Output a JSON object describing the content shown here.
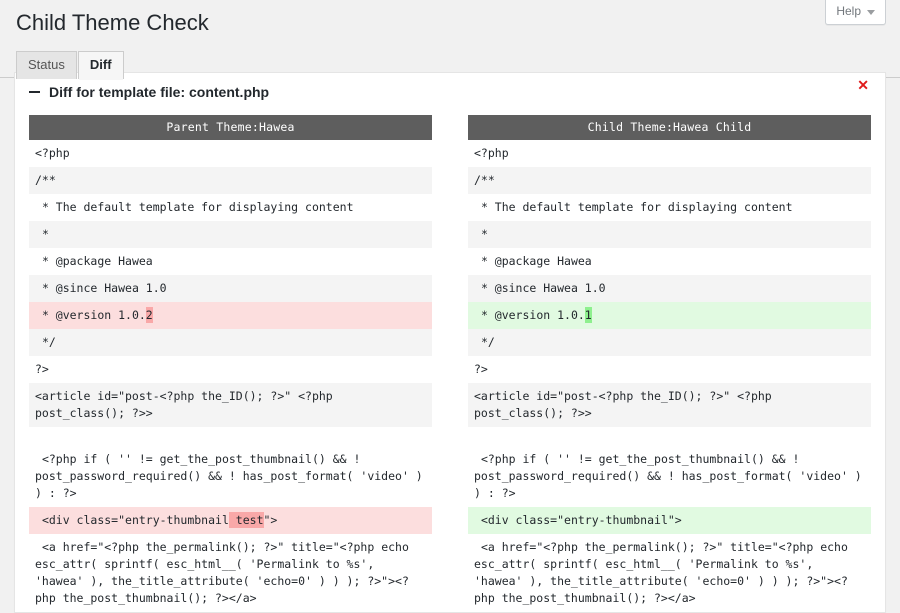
{
  "header": {
    "help_label": "Help",
    "help_icon": "chevron-down-icon"
  },
  "page": {
    "title": "Child Theme Check"
  },
  "tabs": [
    {
      "label": "Status",
      "active": false
    },
    {
      "label": "Diff",
      "active": true
    }
  ],
  "panel": {
    "toggle_icon": "minus-icon",
    "title": "Diff for template file: content.php",
    "close_icon": "close-icon",
    "close_label": "✕"
  },
  "diff": {
    "left": {
      "header": "Parent  Theme:Hawea",
      "lines": [
        {
          "type": "ctx",
          "text": "<?php"
        },
        {
          "type": "ctx",
          "text": "/**"
        },
        {
          "type": "ctx",
          "text": " * The default template for displaying content"
        },
        {
          "type": "ctx",
          "text": " *"
        },
        {
          "type": "ctx",
          "text": " * @package Hawea"
        },
        {
          "type": "ctx",
          "text": " * @since Hawea 1.0"
        },
        {
          "type": "del",
          "pre": " * @version 1.0.",
          "mark": "2",
          "post": ""
        },
        {
          "type": "ctx",
          "text": " */"
        },
        {
          "type": "ctx",
          "text": "?>"
        },
        {
          "type": "ctx",
          "text": "<article id=\"post-<?php the_ID(); ?>\" <?php post_class(); ?>>"
        },
        {
          "type": "spacer",
          "text": ""
        },
        {
          "type": "ctx",
          "text": " <?php if ( '' != get_the_post_thumbnail() && ! post_password_required() && ! has_post_format( 'video' ) ) : ?>"
        },
        {
          "type": "del",
          "pre": " <div class=\"entry-thumbnail",
          "mark": " test",
          "post": "\">"
        },
        {
          "type": "ctx",
          "text": " <a href=\"<?php the_permalink(); ?>\" title=\"<?php echo esc_attr( sprintf( esc_html__( 'Permalink to %s', 'hawea' ), the_title_attribute( 'echo=0' ) ) ); ?>\"><?php the_post_thumbnail(); ?></a>"
        }
      ]
    },
    "right": {
      "header": "Child Theme:Hawea Child",
      "lines": [
        {
          "type": "ctx",
          "text": "<?php"
        },
        {
          "type": "ctx",
          "text": "/**"
        },
        {
          "type": "ctx",
          "text": " * The default template for displaying content"
        },
        {
          "type": "ctx",
          "text": " *"
        },
        {
          "type": "ctx",
          "text": " * @package Hawea"
        },
        {
          "type": "ctx",
          "text": " * @since Hawea 1.0"
        },
        {
          "type": "ins",
          "pre": " * @version 1.0.",
          "mark": "1",
          "post": ""
        },
        {
          "type": "ctx",
          "text": " */"
        },
        {
          "type": "ctx",
          "text": "?>"
        },
        {
          "type": "ctx",
          "text": "<article id=\"post-<?php the_ID(); ?>\" <?php post_class(); ?>>"
        },
        {
          "type": "spacer",
          "text": ""
        },
        {
          "type": "ctx",
          "text": " <?php if ( '' != get_the_post_thumbnail() && ! post_password_required() && ! has_post_format( 'video' ) ) : ?>"
        },
        {
          "type": "ins",
          "pre": " <div class=\"entry-thumbnail\">",
          "mark": "",
          "post": ""
        },
        {
          "type": "ctx",
          "text": " <a href=\"<?php the_permalink(); ?>\" title=\"<?php echo esc_attr( sprintf( esc_html__( 'Permalink to %s', 'hawea' ), the_title_attribute( 'echo=0' ) ) ); ?>\"><?php the_post_thumbnail(); ?></a>"
        }
      ]
    }
  },
  "colors": {
    "page_bg": "#f1f1f1",
    "card_bg": "#ffffff",
    "col_header_bg": "#5e5e5e",
    "delete_bg": "#fcdede",
    "insert_bg": "#e1fae1",
    "delete_chunk": "#f9a8a8",
    "insert_chunk": "#8ef08e",
    "close_red": "#e01b1b"
  }
}
